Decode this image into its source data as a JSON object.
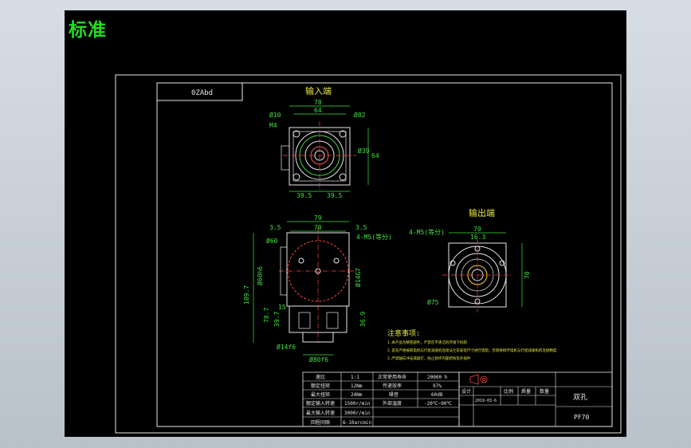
{
  "tab": {
    "label": "标准"
  },
  "sheet": {
    "code_box": "0ZAbd"
  },
  "views": {
    "input": {
      "title": "输入端",
      "dims": {
        "w_outer": "78",
        "w_inner": "64",
        "hole_dia": "Ø10",
        "bolt_dia": "Ø82",
        "thread": "M4",
        "pitch_left": "39.5",
        "pitch_right": "39.5",
        "height": "64",
        "pilot": "Ø39"
      }
    },
    "output": {
      "title": "输出端",
      "dims": {
        "holes": "4-M5(等分)",
        "width": "70",
        "key": "16.3",
        "height": "70",
        "circle": "Ø75"
      }
    },
    "side": {
      "dims": {
        "w_outer": "79",
        "w_inner": "70",
        "left_off": "3.5",
        "right_off": "3.5",
        "bolt_holes": "4-M5(等分)",
        "dia_60": "Ø60",
        "dia_h6": "Ø60h6",
        "dia_63": "Ø14G7",
        "height_total": "109.7",
        "h_15": "15",
        "h_78": "78.7",
        "h_36": "36.9",
        "h_39": "39.7",
        "shaft": "Ø14f6",
        "flange": "Ø80f6"
      }
    }
  },
  "notes": {
    "title": "注意事项:",
    "lines": [
      "1.本产品为精密部件，严禁在不清洁的环境下拆卸",
      "2.首先严格按照电机与行星减速机连接法兰及安装尺寸进行装配，否则将损坏电机与行星减速机的连接精度",
      "3.严禁轴向冲击或敲打，防止损坏内部结构及外观件"
    ]
  },
  "spec": {
    "rows": [
      [
        "速比",
        "1:1",
        "正常使用寿命",
        "20000 h"
      ],
      [
        "额定扭矩",
        "12Nm",
        "传递效率",
        "97%"
      ],
      [
        "最大扭矩",
        "24Nm",
        "噪音",
        "60dB"
      ],
      [
        "额定输入转速",
        "1500r/min",
        "外部温度",
        "-20℃~90℃"
      ],
      [
        "最大输入转速",
        "3000r/min",
        "",
        ""
      ],
      [
        "回程间隙",
        "6-10arcmin",
        "",
        ""
      ]
    ]
  },
  "title_block": {
    "labels": [
      "设计",
      "比例",
      "质量",
      "数量"
    ],
    "designer": "2019-03-6",
    "name": "双孔",
    "model": "PF70"
  }
}
